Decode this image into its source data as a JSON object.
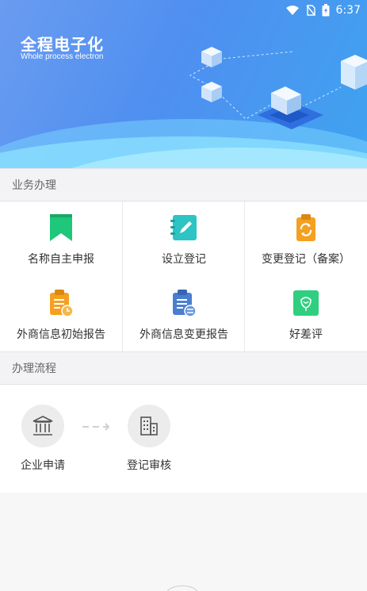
{
  "status_bar": {
    "time": "6:37"
  },
  "banner": {
    "title": "全程电子化",
    "subtitle": "Whole process electron"
  },
  "sections": {
    "business": "业务办理",
    "process": "办理流程"
  },
  "services": [
    {
      "label": "名称自主申报",
      "icon": "bookmark-icon",
      "color": "#1ec77a"
    },
    {
      "label": "设立登记",
      "icon": "notebook-pen-icon",
      "color": "#2ec4c4"
    },
    {
      "label": "变更登记（备案）",
      "icon": "clipboard-refresh-icon",
      "color": "#f5a020"
    },
    {
      "label": "外商信息初始报告",
      "icon": "clipboard-report-icon",
      "color": "#f5a020"
    },
    {
      "label": "外商信息变更报告",
      "icon": "clipboard-exchange-icon",
      "color": "#4a7fd0"
    },
    {
      "label": "好差评",
      "icon": "rating-icon",
      "color": "#2fcf7f"
    }
  ],
  "flow_steps": [
    {
      "label": "企业申请",
      "icon": "bank-building-icon"
    },
    {
      "label": "登记审核",
      "icon": "office-building-icon"
    }
  ]
}
